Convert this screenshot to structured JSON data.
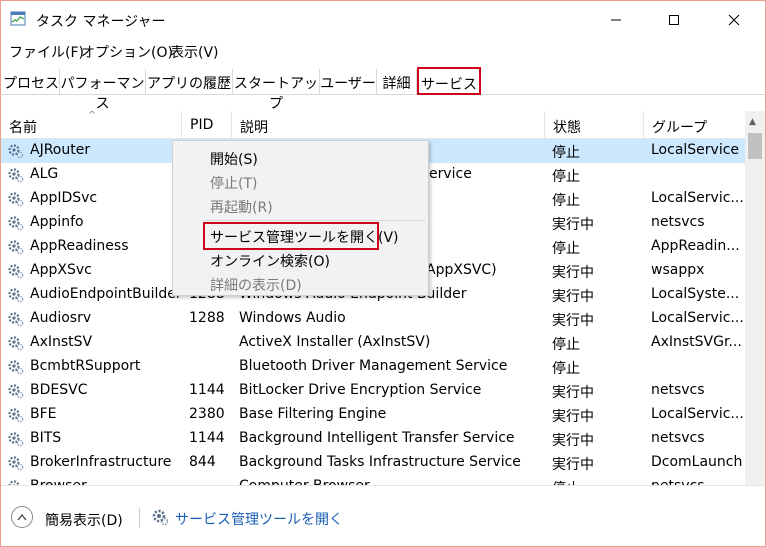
{
  "window": {
    "title": "タスク マネージャー"
  },
  "menubar": {
    "items": [
      "ファイル(F)",
      "オプション(O)",
      "表示(V)"
    ]
  },
  "tabs": [
    "プロセス",
    "パフォーマンス",
    "アプリの履歴",
    "スタートアップ",
    "ユーザー",
    "詳細",
    "サービス"
  ],
  "active_tab": "サービス",
  "table": {
    "columns": [
      "名前",
      "PID",
      "説明",
      "状態",
      "グループ"
    ],
    "rows": [
      {
        "name": "AJRouter",
        "pid": "",
        "desc": "",
        "status": "停止",
        "group": "LocalService"
      },
      {
        "name": "ALG",
        "pid": "",
        "desc": "ervice",
        "status": "停止",
        "group": ""
      },
      {
        "name": "AppIDSvc",
        "pid": "",
        "desc": "",
        "status": "停止",
        "group": "LocalServic..."
      },
      {
        "name": "Appinfo",
        "pid": "",
        "desc": "",
        "status": "実行中",
        "group": "netsvcs"
      },
      {
        "name": "AppReadiness",
        "pid": "",
        "desc": "",
        "status": "停止",
        "group": "AppReadin..."
      },
      {
        "name": "AppXSvc",
        "pid": "",
        "desc": "AppXSVC)",
        "status": "実行中",
        "group": "wsappx"
      },
      {
        "name": "AudioEndpointBuilder",
        "pid": "1288",
        "desc": "Windows Audio Endpoint Builder",
        "status": "実行中",
        "group": "LocalSyste..."
      },
      {
        "name": "Audiosrv",
        "pid": "1288",
        "desc": "Windows Audio",
        "status": "実行中",
        "group": "LocalServic..."
      },
      {
        "name": "AxInstSV",
        "pid": "",
        "desc": "ActiveX Installer (AxInstSV)",
        "status": "停止",
        "group": "AxInstSVGr..."
      },
      {
        "name": "BcmbtRSupport",
        "pid": "",
        "desc": "Bluetooth Driver Management Service",
        "status": "停止",
        "group": ""
      },
      {
        "name": "BDESVC",
        "pid": "1144",
        "desc": "BitLocker Drive Encryption Service",
        "status": "実行中",
        "group": "netsvcs"
      },
      {
        "name": "BFE",
        "pid": "2380",
        "desc": "Base Filtering Engine",
        "status": "実行中",
        "group": "LocalServic..."
      },
      {
        "name": "BITS",
        "pid": "1144",
        "desc": "Background Intelligent Transfer Service",
        "status": "実行中",
        "group": "netsvcs"
      },
      {
        "name": "BrokerInfrastructure",
        "pid": "844",
        "desc": "Background Tasks Infrastructure Service",
        "status": "実行中",
        "group": "DcomLaunch"
      },
      {
        "name": "Browser",
        "pid": "",
        "desc": "Computer Browser",
        "status": "停止",
        "group": "netsvcs"
      }
    ]
  },
  "context_menu": {
    "items": [
      {
        "label": "開始(S)",
        "disabled": false
      },
      {
        "label": "停止(T)",
        "disabled": true
      },
      {
        "label": "再起動(R)",
        "disabled": true
      },
      {
        "label": "サービス管理ツールを開く(V)",
        "disabled": false
      },
      {
        "label": "オンライン検索(O)",
        "disabled": false
      },
      {
        "label": "詳細の表示(D)",
        "disabled": true
      }
    ]
  },
  "footer": {
    "fewer_details": "簡易表示(D)",
    "open_services": "サービス管理ツールを開く"
  },
  "colors": {
    "highlight_red": "#d0021b",
    "selection": "#cce8ff",
    "link": "#1a5fb4"
  },
  "icons": {
    "app": "task-manager-icon",
    "service": "gear-service-icon"
  }
}
